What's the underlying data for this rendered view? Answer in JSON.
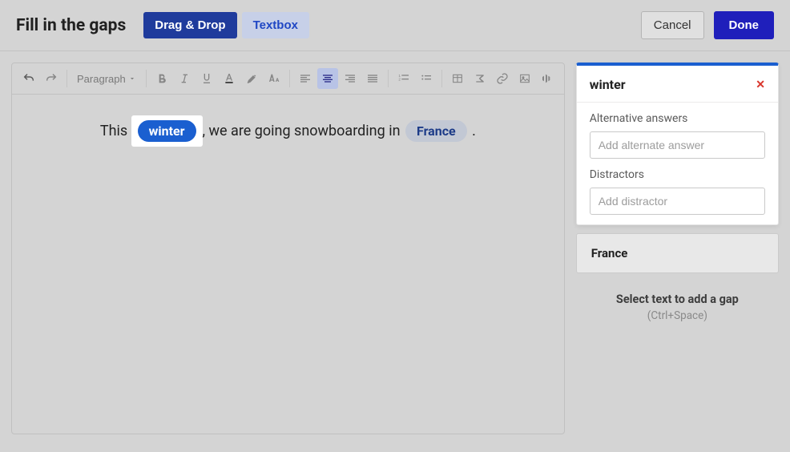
{
  "header": {
    "title": "Fill in the gaps",
    "tabs": {
      "drag_drop": "Drag & Drop",
      "textbox": "Textbox"
    },
    "cancel": "Cancel",
    "done": "Done"
  },
  "toolbar": {
    "paragraph_label": "Paragraph"
  },
  "sentence": {
    "part1": "This ",
    "gap1": "winter",
    "part2": ", we are going snowboarding in ",
    "gap2": "France",
    "part3": " ."
  },
  "gap_panel": {
    "active_word": "winter",
    "alt_label": "Alternative answers",
    "alt_placeholder": "Add alternate answer",
    "distractors_label": "Distractors",
    "distractors_placeholder": "Add distractor",
    "other_gap": "France",
    "hint_title": "Select text to add a gap",
    "hint_sub": "(Ctrl+Space)"
  }
}
